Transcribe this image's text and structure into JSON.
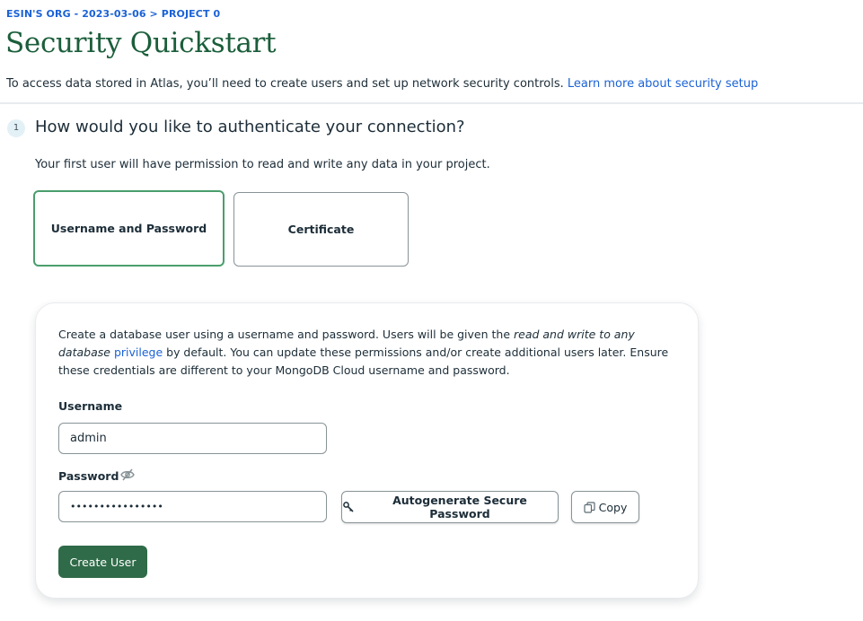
{
  "breadcrumb": {
    "org": "ESIN'S ORG - 2023-03-06",
    "separator": ">",
    "project": "PROJECT 0"
  },
  "page": {
    "title": "Security Quickstart",
    "intro_text": "To access data stored in Atlas, you’ll need to create users and set up network security controls.",
    "intro_link": "Learn more about security setup"
  },
  "step": {
    "number": "1",
    "title": "How would you like to authenticate your connection?",
    "description": "Your first user will have permission to read and write any data in your project."
  },
  "auth_options": {
    "username_password": "Username and Password",
    "certificate": "Certificate",
    "selected": "Username and Password"
  },
  "card": {
    "text_before": "Create a database user using a username and password. Users will be given the ",
    "text_italic": "read and write to any database",
    "text_link": "privilege",
    "text_after": " by default. You can update these permissions and/or create additional users later. Ensure these credentials are different to your MongoDB Cloud username and password.",
    "username_label": "Username",
    "username_value": "admin",
    "password_label": "Password",
    "password_value": "••••••••••••••••",
    "autogenerate_label": "Autogenerate Secure Password",
    "copy_label": "Copy",
    "create_label": "Create User"
  },
  "icons": {
    "eye": "eye-slash-icon",
    "key": "key-icon",
    "copy": "copy-icon"
  },
  "colors": {
    "link": "#1a62d6",
    "title_green": "#1b5e3b",
    "selected_border": "#4a9e6c",
    "primary_button": "#2f6b48"
  }
}
